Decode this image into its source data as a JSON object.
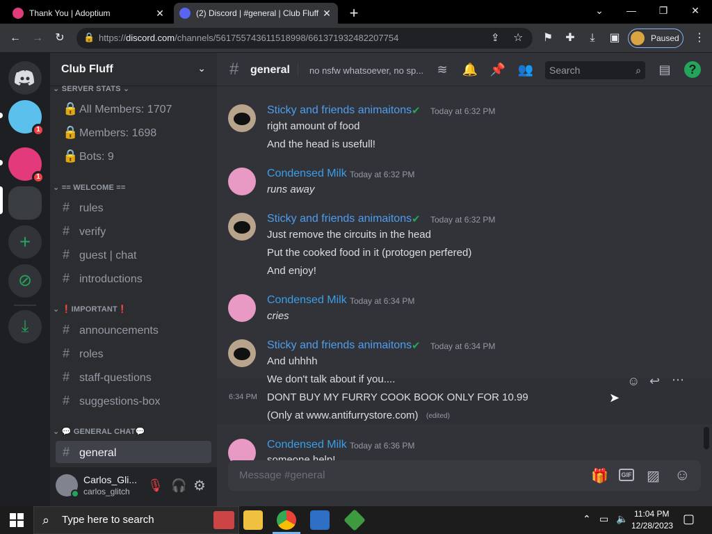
{
  "browser": {
    "tabs": [
      {
        "title": "Thank You | Adoptium",
        "active": false
      },
      {
        "title": "(2) Discord | #general | Club Fluff",
        "active": true
      }
    ],
    "new_tab_label": "+",
    "url_prefix": "https://",
    "url_host": "discord.com",
    "url_path": "/channels/561755743611518998/661371932482207754",
    "profile_status": "Paused"
  },
  "server": {
    "name": "Club Fluff",
    "categories": [
      {
        "name": "SERVER STATS",
        "channels": [
          "All Members: 1707",
          "Members: 1698",
          "Bots: 9"
        ]
      },
      {
        "name": "== WELCOME ==",
        "channels": [
          "rules",
          "verify",
          "guest | chat",
          "introductions"
        ]
      },
      {
        "name": "❗IMPORTANT❗",
        "channels": [
          "announcements",
          "roles",
          "staff-questions",
          "suggestions-box"
        ]
      },
      {
        "name": "💬 GENERAL CHAT💬",
        "channels": [
          "general"
        ]
      }
    ]
  },
  "guild_badges": [
    "1",
    "1"
  ],
  "user": {
    "display_name": "Carlos_Gli...",
    "username": "carlos_glitch"
  },
  "channel": {
    "name": "general",
    "topic": "no nsfw whatsoever, no sp...",
    "search_placeholder": "Search"
  },
  "messages": [
    {
      "author": "Sticky and friends animaitons",
      "time": "Today at 6:32 PM",
      "color": "#4e9ef0",
      "lines": [
        "right amount of food",
        "And the head is usefull!"
      ]
    },
    {
      "author": "Condensed Milk",
      "time": "Today at 6:32 PM",
      "color": "#3c9ee6",
      "lines": [
        "runs away"
      ]
    },
    {
      "author": "Sticky and friends animaitons",
      "time": "Today at 6:32 PM",
      "color": "#4e9ef0",
      "lines": [
        "Just remove the circuits in the head",
        "Put the cooked food in it (protogen perfered)",
        "And enjoy!"
      ]
    },
    {
      "author": "Condensed Milk",
      "time": "Today at 6:34 PM",
      "color": "#3c9ee6",
      "lines": [
        "cries"
      ]
    },
    {
      "author": "Sticky and friends animaitons",
      "time": "Today at 6:34 PM",
      "color": "#4e9ef0",
      "lines": [
        "And uhhhh",
        "We don't talk about if you....",
        "DONT BUY MY FURRY COOK BOOK ONLY FOR 10.99",
        "(Only at www.antifurrystore.com)"
      ],
      "hover_time": "6:34 PM",
      "edited": "(edited)"
    },
    {
      "author": "Condensed Milk",
      "time": "Today at 6:36 PM",
      "color": "#3c9ee6",
      "lines": [
        "someone help!"
      ]
    }
  ],
  "composer_placeholder": "Message #general",
  "taskbar": {
    "search_placeholder": "Type here to search",
    "time": "11:04 PM",
    "date": "12/28/2023"
  },
  "colors": {
    "discord_bg": "#313338",
    "sidebar_bg": "#2b2d31",
    "guild_bg": "#1e1f22",
    "accent": "#5865f2",
    "green": "#23a55a",
    "red": "#f23f42"
  }
}
